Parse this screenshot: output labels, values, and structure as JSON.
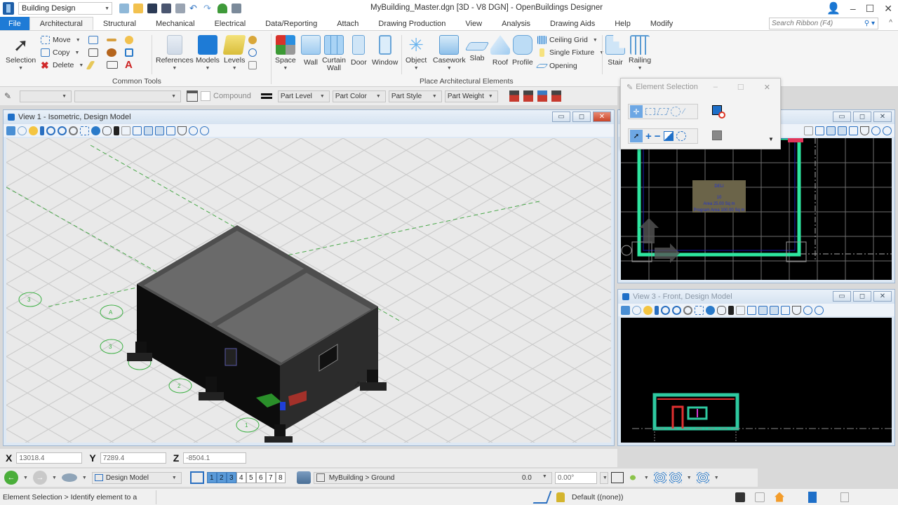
{
  "titlebar": {
    "workspace": "Building Design",
    "title": "MyBuilding_Master.dgn [3D - V8 DGN] - OpenBuildings Designer",
    "minimize": "–",
    "maximize": "☐",
    "close": "✕"
  },
  "tabs": [
    "File",
    "Architectural",
    "Structural",
    "Mechanical",
    "Electrical",
    "Data/Reporting",
    "Attach",
    "Drawing Production",
    "View",
    "Analysis",
    "Drawing Aids",
    "Help",
    "Modify"
  ],
  "active_tab": "Architectural",
  "search_ribbon": {
    "placeholder": "Search Ribbon (F4)"
  },
  "ribbon": {
    "common_tools": {
      "label": "Common Tools",
      "selection": "Selection",
      "move": "Move",
      "copy": "Copy",
      "delete": "Delete",
      "references": "References",
      "models": "Models",
      "levels": "Levels"
    },
    "place_architectural": {
      "label": "Place Architectural Elements",
      "space": "Space",
      "wall": "Wall",
      "curtain_wall": "Curtain Wall",
      "door": "Door",
      "window": "Window",
      "object": "Object",
      "casework": "Casework",
      "slab": "Slab",
      "roof": "Roof",
      "profile": "Profile",
      "ceiling_grid": "Ceiling Grid",
      "single_fixture": "Single Fixture",
      "opening": "Opening",
      "stair": "Stair",
      "railing": "Railing"
    }
  },
  "attributes": {
    "compound": "Compound",
    "part_level": "Part Level",
    "part_color": "Part Color",
    "part_style": "Part Style",
    "part_weight": "Part Weight"
  },
  "views": {
    "view1": {
      "title": "View 1 - Isometric, Design Model"
    },
    "view3": {
      "title": "View 3 - Front, Design Model"
    },
    "view2": {
      "space_label": {
        "name": "DELI",
        "number": "10",
        "area": "Area 25.00 Sq m",
        "program_area": "Program Area 100.00 Sq m"
      }
    },
    "grid_bubbles": [
      "3",
      "A",
      "3",
      "2",
      "1"
    ]
  },
  "element_selection": {
    "title": "Element Selection"
  },
  "coords": {
    "x_label": "X",
    "x": "13018.4",
    "y_label": "Y",
    "y": "7289.4",
    "z_label": "Z",
    "z": "-8504.1"
  },
  "nav": {
    "model": "Design Model",
    "view_numbers": [
      "1",
      "2",
      "3",
      "4",
      "5",
      "6",
      "7",
      "8"
    ],
    "active_views": [
      "1",
      "2",
      "3"
    ],
    "level_path": "MyBuilding > Ground",
    "active_angle_value": "0.0",
    "angle": "0.00°"
  },
  "status": {
    "prompt": "Element Selection > Identify element to a",
    "level": "Default ((none))"
  },
  "colors": {
    "accent": "#1e7bd6",
    "wall_green": "#2ee6a0",
    "view_bg": "#000000"
  }
}
